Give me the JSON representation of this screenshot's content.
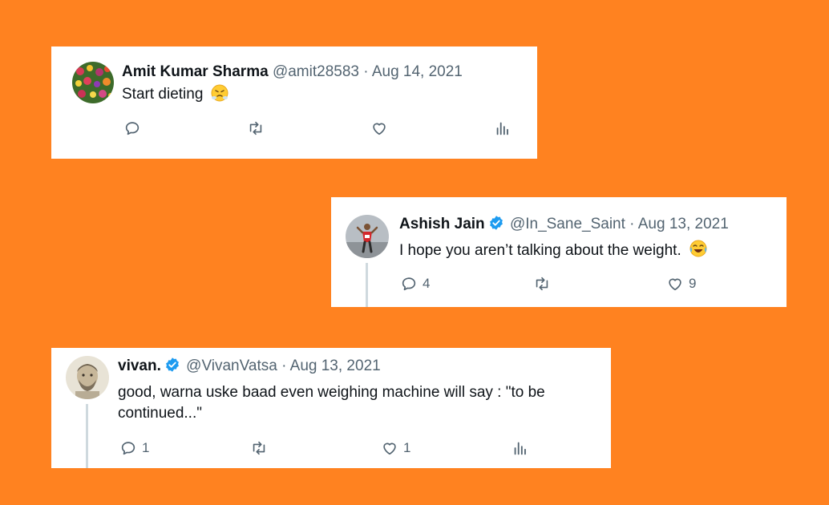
{
  "tweets": [
    {
      "name": "Amit Kumar Sharma",
      "handle": "@amit28583",
      "separator": "·",
      "date": "Aug 14, 2021",
      "text": "Start dieting",
      "emoji": "face-with-steam-from-nose",
      "verified": false,
      "actions": {
        "reply": "",
        "retweet": "",
        "like": "",
        "views": ""
      }
    },
    {
      "name": "Ashish Jain",
      "handle": "@In_Sane_Saint",
      "separator": "·",
      "date": "Aug 13, 2021",
      "text": "I hope you aren’t talking about the weight.",
      "emoji": "face-with-tears-of-joy",
      "verified": true,
      "actions": {
        "reply": "4",
        "retweet": "",
        "like": "9"
      }
    },
    {
      "name": "vivan.",
      "handle": "@VivanVatsa",
      "separator": "·",
      "date": "Aug 13, 2021",
      "text_line1": "good, warna uske baad even weighing machine will say : \"to be",
      "text_line2": "continued...\"",
      "verified": true,
      "actions": {
        "reply": "1",
        "retweet": "",
        "like": "1",
        "views": ""
      }
    }
  ],
  "colors": {
    "background": "#FF8220",
    "card": "#FFFFFF",
    "verified": "#1D9BF0",
    "secondary_text": "#536471"
  }
}
